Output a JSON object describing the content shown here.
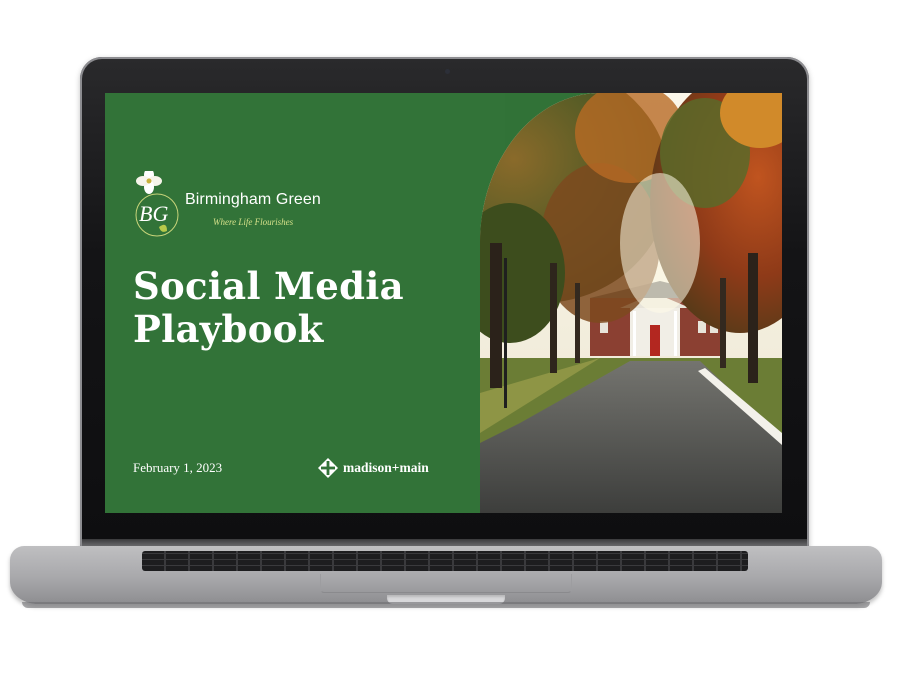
{
  "slide": {
    "logo": {
      "monogram": "BG",
      "brand_name": "Birmingham Green",
      "tagline": "Where Life Flourishes"
    },
    "title_line1": "Social Media",
    "title_line2": "Playbook",
    "date": "February 1, 2023",
    "partner_logo": "madison+main"
  },
  "colors": {
    "slide_green": "#327338",
    "tagline_yellow": "#d5e08a",
    "text_white": "#ffffff"
  },
  "icons": {
    "logo_flower": "dogwood-flower-icon",
    "partner_mark": "diamond-cross-icon"
  }
}
